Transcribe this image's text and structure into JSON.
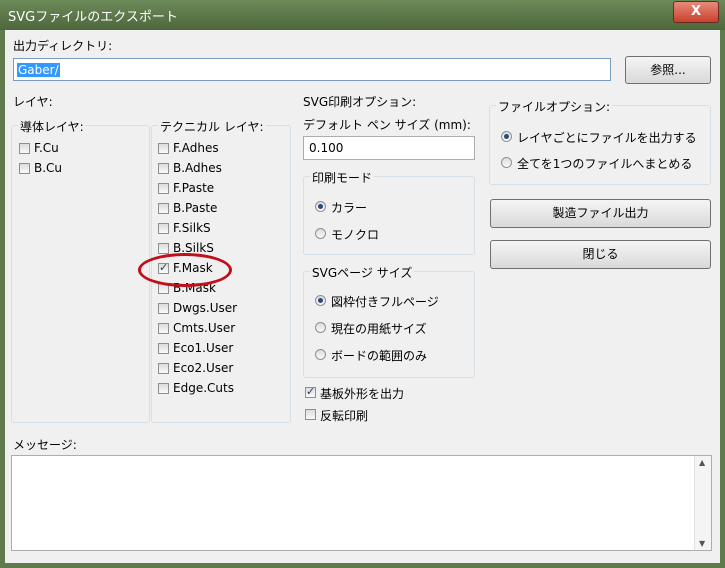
{
  "window": {
    "title": "SVGファイルのエクスポート",
    "close_label": "X"
  },
  "output_dir": {
    "label": "出力ディレクトリ:",
    "value": "Gaber/",
    "browse_label": "参照..."
  },
  "layers": {
    "group_label": "レイヤ:",
    "copper": {
      "label": "導体レイヤ:",
      "items": [
        {
          "name": "F.Cu",
          "checked": false
        },
        {
          "name": "B.Cu",
          "checked": false
        }
      ]
    },
    "technical": {
      "label": "テクニカル レイヤ:",
      "items": [
        {
          "name": "F.Adhes",
          "checked": false
        },
        {
          "name": "B.Adhes",
          "checked": false
        },
        {
          "name": "F.Paste",
          "checked": false
        },
        {
          "name": "B.Paste",
          "checked": false
        },
        {
          "name": "F.SilkS",
          "checked": false
        },
        {
          "name": "B.SilkS",
          "checked": false
        },
        {
          "name": "F.Mask",
          "checked": true
        },
        {
          "name": "B.Mask",
          "checked": false
        },
        {
          "name": "Dwgs.User",
          "checked": false
        },
        {
          "name": "Cmts.User",
          "checked": false
        },
        {
          "name": "Eco1.User",
          "checked": false
        },
        {
          "name": "Eco2.User",
          "checked": false
        },
        {
          "name": "Edge.Cuts",
          "checked": false
        }
      ]
    }
  },
  "svg_options": {
    "label": "SVG印刷オプション:",
    "pen_label": "デフォルト ペン サイズ (mm):",
    "pen_value": "0.100",
    "print_mode": {
      "label": "印刷モード",
      "options": [
        "カラー",
        "モノクロ"
      ],
      "selected": 0
    },
    "page_size": {
      "label": "SVGページ サイズ",
      "options": [
        "図枠付きフルページ",
        "現在の用紙サイズ",
        "ボードの範囲のみ"
      ],
      "selected": 0
    },
    "plot_edges": {
      "label": "基板外形を出力",
      "checked": true
    },
    "mirror": {
      "label": "反転印刷",
      "checked": false
    }
  },
  "file_options": {
    "label": "ファイルオプション:",
    "options": [
      "レイヤごとにファイルを出力する",
      "全てを1つのファイルへまとめる"
    ],
    "selected": 0
  },
  "buttons": {
    "export": "製造ファイル出力",
    "close": "閉じる"
  },
  "messages": {
    "label": "メッセージ:"
  },
  "colors": {
    "highlight": "#3399ff",
    "annotation": "#c0101a"
  }
}
